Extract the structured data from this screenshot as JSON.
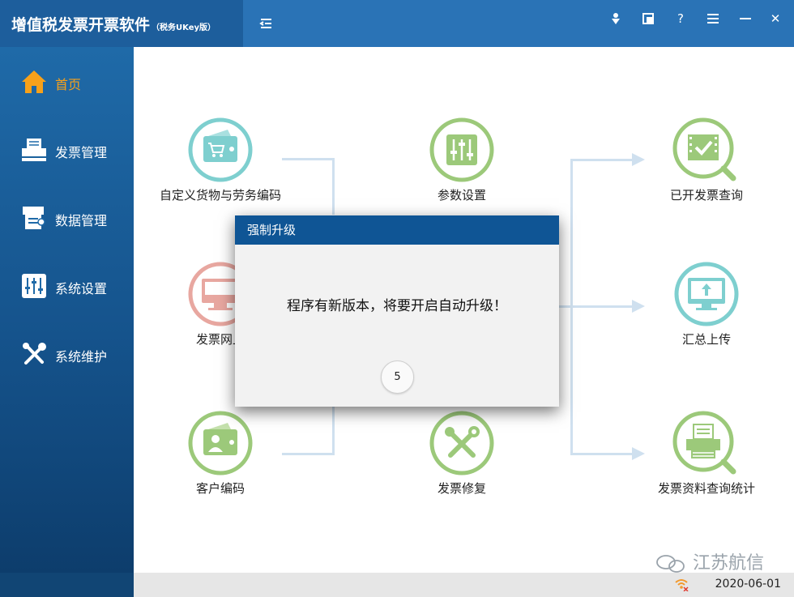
{
  "app": {
    "title": "增值税发票开票软件",
    "subtitle": "（税务UKey版）"
  },
  "toolbar": {
    "icons": [
      "person-icon",
      "window-icon",
      "help-icon",
      "menu-icon",
      "minimize-icon",
      "close-icon"
    ],
    "help_glyph": "?",
    "close_glyph": "✕"
  },
  "sidebar": {
    "items": [
      {
        "label": "首页",
        "icon": "home-icon",
        "active": true
      },
      {
        "label": "发票管理",
        "icon": "printer-icon"
      },
      {
        "label": "数据管理",
        "icon": "data-icon"
      },
      {
        "label": "系统设置",
        "icon": "sliders-icon"
      },
      {
        "label": "系统维护",
        "icon": "tools-icon"
      }
    ]
  },
  "features": {
    "goods_coding": "自定义货物与劳务编码",
    "params": "参数设置",
    "issued_query": "已开发票查询",
    "online": "发票网上",
    "summary_upload": "汇总上传",
    "customer_coding": "客户编码",
    "repair": "发票修复",
    "stats": "发票资料查询统计"
  },
  "dialog": {
    "title": "强制升级",
    "message": "程序有新版本，将要开启自动升级！",
    "countdown": "5"
  },
  "status": {
    "date": "2020-06-01"
  },
  "watermark": {
    "text": "江苏航信"
  },
  "colors": {
    "header": "#2a73b6",
    "sidebar": "#1f6aa8",
    "accent": "#f7a11a",
    "teal": "#7ecfcf",
    "green": "#9cc97a",
    "pink": "#e8a7a0"
  }
}
